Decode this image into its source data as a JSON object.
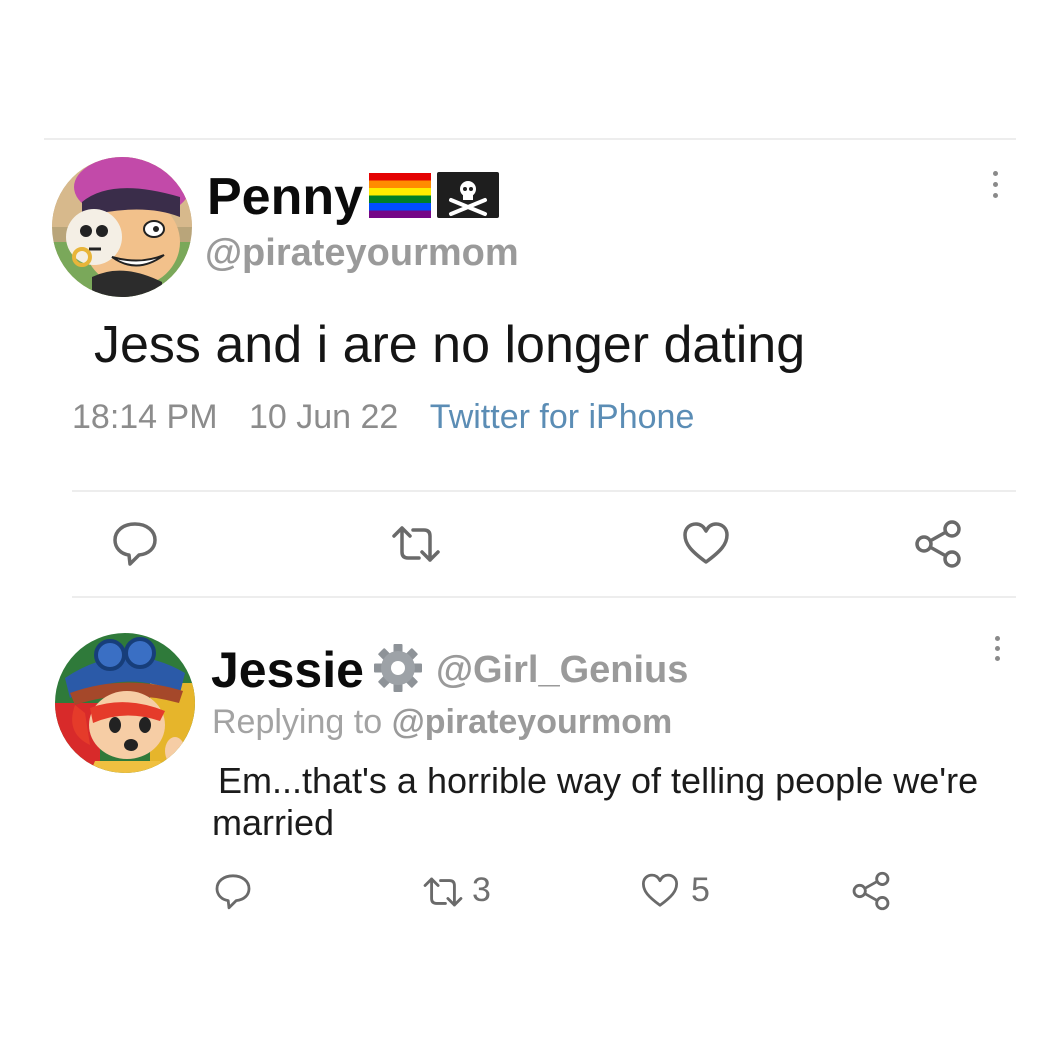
{
  "tweet": {
    "display_name": "Penny",
    "name_emojis": [
      "rainbow-flag-icon",
      "pirate-flag-icon"
    ],
    "handle": "@pirateyourmom",
    "text": "Jess and i are no longer dating",
    "time": "18:14 PM",
    "date": "10 Jun 22",
    "source": "Twitter for iPhone"
  },
  "reply": {
    "display_name": "Jessie",
    "name_emoji": "gear-icon",
    "handle": "@Girl_Genius",
    "replying_prefix": "Replying to",
    "replying_handle": "@pirateyourmom",
    "text": "Em...that's a horrible way of telling people we're married",
    "retweets": "3",
    "likes": "5"
  },
  "colors": {
    "source_link": "#5b8db5",
    "handle_gray": "#9a9a9a",
    "icon_gray": "#6a6a6a"
  }
}
